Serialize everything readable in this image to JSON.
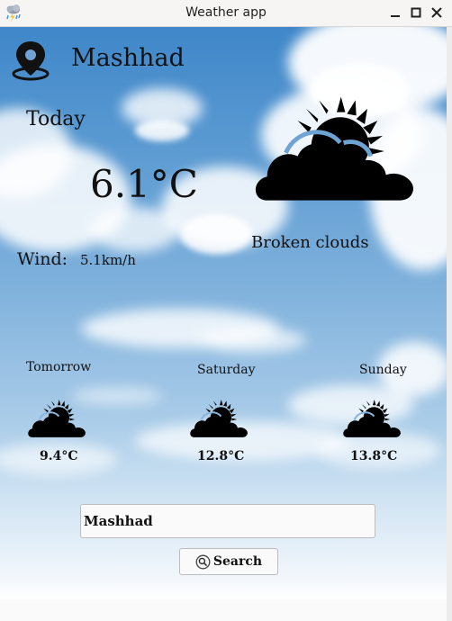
{
  "window": {
    "title": "Weather app",
    "app_icon": "weather-app-icon",
    "controls": [
      "minimize-icon",
      "maximize-icon",
      "close-icon"
    ]
  },
  "location": {
    "icon": "location-pin-icon",
    "city": "Mashhad"
  },
  "today": {
    "label": "Today",
    "temperature": "6.1°C",
    "condition": "Broken clouds",
    "condition_icon": "broken-clouds-icon",
    "wind_label": "Wind:",
    "wind_value": "5.1km/h"
  },
  "forecast": [
    {
      "day": "Tomorrow",
      "temperature": "9.4°C",
      "icon": "broken-clouds-icon"
    },
    {
      "day": "Saturday",
      "temperature": "12.8°C",
      "icon": "broken-clouds-icon"
    },
    {
      "day": "Sunday",
      "temperature": "13.8°C",
      "icon": "broken-clouds-icon"
    }
  ],
  "search": {
    "value": "Mashhad",
    "button_label": "Search",
    "button_icon": "search-icon"
  }
}
